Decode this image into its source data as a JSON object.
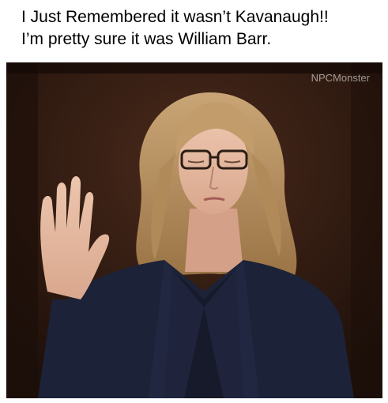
{
  "caption": {
    "line1": "I Just Remembered it wasn’t Kavanaugh!!",
    "line2": "I’m pretty sure it was William Barr."
  },
  "photo": {
    "watermark": "NPCMonster",
    "background_color": "#2a1710",
    "jacket_color": "#1c2237",
    "hair_color": "#b58f5e",
    "skin_color": "#e3b8a0"
  }
}
